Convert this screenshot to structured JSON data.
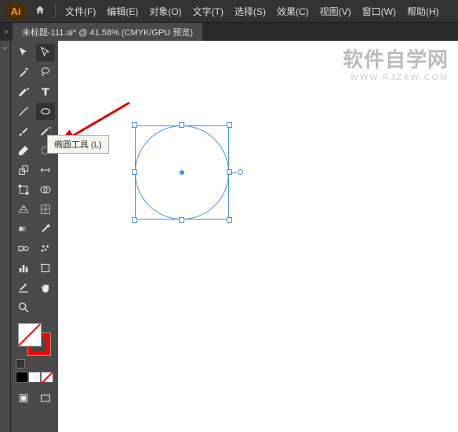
{
  "app": {
    "logo": "Ai"
  },
  "menu": {
    "file": "文件(F)",
    "edit": "编辑(E)",
    "object": "对象(O)",
    "type": "文字(T)",
    "select": "选择(S)",
    "effect": "效果(C)",
    "view": "视图(V)",
    "window": "窗口(W)",
    "help": "帮助(H)"
  },
  "doc": {
    "tab_label": "未标题-111.ai* @ 41.58% (CMYK/GPU 预览)"
  },
  "tooltip": {
    "ellipse": "椭圆工具 (L)"
  },
  "watermark": {
    "main": "软件自学网",
    "sub": "WWW.RJZXW.COM"
  },
  "tools": {
    "selection": "selection-tool",
    "direct": "direct-selection-tool",
    "wand": "magic-wand-tool",
    "lasso": "lasso-tool",
    "pen": "pen-tool",
    "type": "type-tool",
    "line": "line-tool",
    "ellipse": "ellipse-tool",
    "brush": "paintbrush-tool",
    "pencil": "pencil-tool",
    "eraser": "eraser-tool",
    "rotge": "rotate-tool",
    "scale": "scale-tool",
    "width": "width-tool",
    "free": "free-transform-tool",
    "shapebuilder": "shape-builder-tool",
    "perspective": "perspective-grid-tool",
    "mesh": "mesh-tool",
    "gradient": "gradient-tool",
    "eyedropper": "eyedropper-tool",
    "blend": "blend-tool",
    "symbol": "symbol-sprayer-tool",
    "graph": "column-graph-tool",
    "artboard": "artboard-tool",
    "slice": "slice-tool",
    "hand": "hand-tool",
    "zoom": "zoom-tool"
  }
}
